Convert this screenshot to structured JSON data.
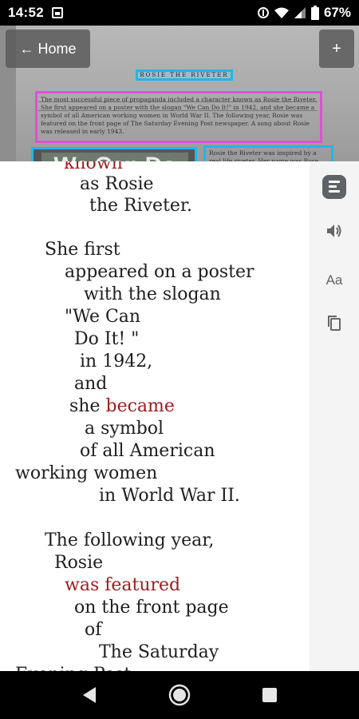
{
  "status_bar": {
    "time": "14:52",
    "battery_text": "67%"
  },
  "camera": {
    "header_text": "ROSIE THE RIVETER",
    "magenta_text": "The most successful piece of propaganda included a character known as Rosie the Riveter. She first appeared on a poster with the slogan \"We Can Do It!\" in 1942, and she became a symbol of all American working women in World War II. The following year, Rosie was featured on the front page of The Saturday Evening Post newspaper. A song about Rosie was released in early 1943.",
    "poster_text": "We Can Do It!",
    "right_text": "Rosie the Riveter was inspired by a real life riveter. Her name was Rose Will Monroe. She was born in Kentucky in 1920. During the war,"
  },
  "toolbar": {
    "home_label": "← Home",
    "add_label": "+"
  },
  "reading": {
    "lines": [
      {
        "text": "known",
        "highlight": true
      },
      {
        "text": "as Rosie",
        "highlight": false
      },
      {
        "text": "the Riveter.",
        "highlight": false
      },
      {
        "text": "She first",
        "highlight": false
      },
      {
        "text": "appeared on a poster",
        "highlight": false
      },
      {
        "text": "with the slogan",
        "highlight": false
      },
      {
        "text": "\"We Can",
        "highlight": false
      },
      {
        "text": "Do It! \"",
        "highlight": false
      },
      {
        "text": "in 1942,",
        "highlight": false
      },
      {
        "text": "and",
        "highlight": false
      },
      {
        "text_pre": "she ",
        "text_hl": "became",
        "highlight": "partial"
      },
      {
        "text": "a symbol",
        "highlight": false
      },
      {
        "text": "of all American",
        "highlight": false
      },
      {
        "text": "working women",
        "highlight": false
      },
      {
        "text": "in World War II.",
        "highlight": false
      },
      {
        "text": "The following year,",
        "highlight": false
      },
      {
        "text": "Rosie",
        "highlight": false
      },
      {
        "text": "was featured",
        "highlight": true
      },
      {
        "text": "on the front page",
        "highlight": false
      },
      {
        "text": "of",
        "highlight": false
      },
      {
        "text": "The Saturday",
        "highlight": false
      },
      {
        "text": "Evening Post",
        "highlight": false
      }
    ]
  },
  "tools": {
    "font_label": "Aa",
    "icons": [
      "summary-icon",
      "speaker-icon",
      "font-size-icon",
      "copy-icon"
    ]
  },
  "colors": {
    "highlight": "#9b1d1d",
    "box_blue": "#21b8e6",
    "box_magenta": "#e04fd6"
  }
}
